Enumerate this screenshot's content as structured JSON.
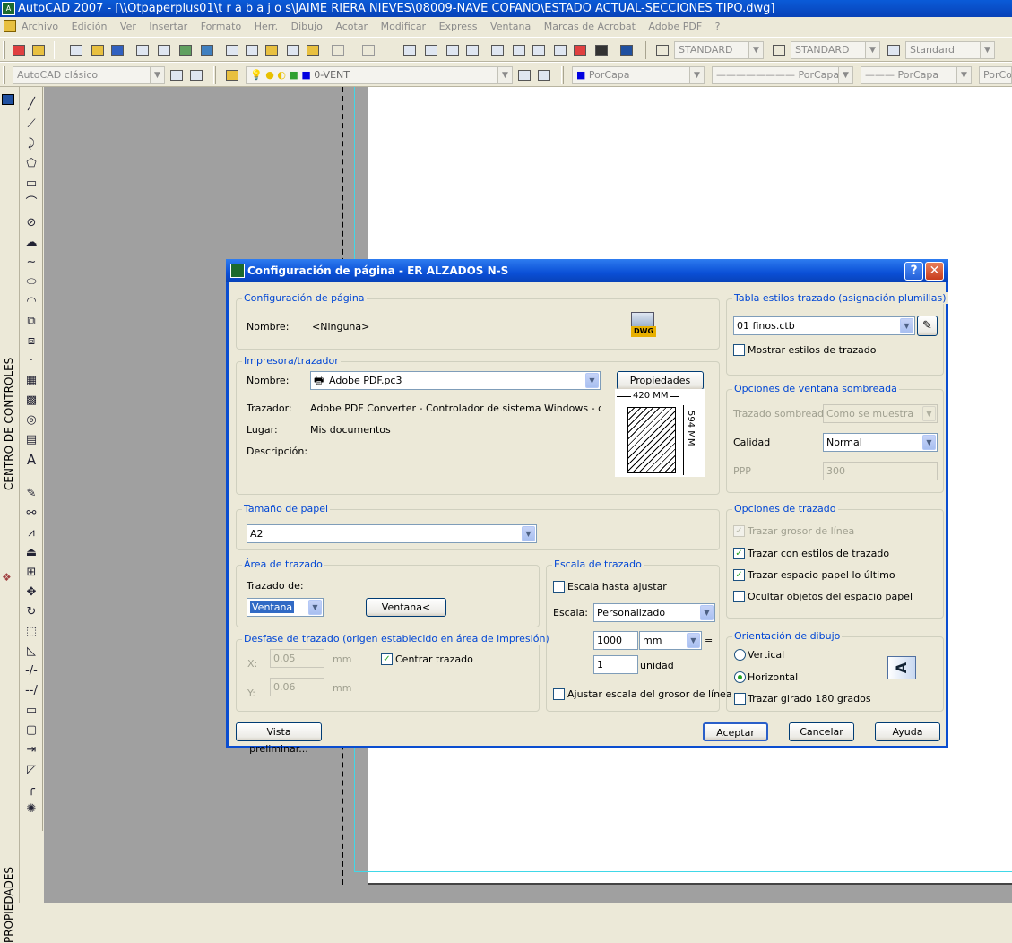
{
  "window": {
    "title": "AutoCAD 2007 - [\\\\Otpaperplus01\\t r a b a j o s\\JAIME RIERA NIEVES\\08009-NAVE COFANO\\ESTADO ACTUAL-SECCIONES TIPO.dwg]"
  },
  "menu": [
    "Archivo",
    "Edición",
    "Ver",
    "Insertar",
    "Formato",
    "Herr.",
    "Dibujo",
    "Acotar",
    "Modificar",
    "Express",
    "Ventana",
    "Marcas de Acrobat",
    "Adobe PDF",
    "?"
  ],
  "toolbar1": {
    "text_style": "STANDARD",
    "dim_style": "STANDARD",
    "table_style": "Standard"
  },
  "toolbar2": {
    "workspace": "AutoCAD clásico",
    "layer": "0-VENT",
    "color": "PorCapa",
    "linetype": "PorCapa",
    "lineweight": "PorCapa",
    "plotstyle": "PorCo"
  },
  "side_palettes": {
    "design_center": "CENTRO DE CONTROLES",
    "properties": "PROPIEDADES"
  },
  "dialog": {
    "title": "Configuración de página - ER  ALZADOS N-S",
    "help_glyph": "?",
    "close_glyph": "✕",
    "page_setup": {
      "legend": "Configuración de página",
      "name_label": "Nombre:",
      "name_value": "<Ninguna>",
      "dwg_badge": "DWG"
    },
    "printer": {
      "legend": "Impresora/trazador",
      "name_label": "Nombre:",
      "name_value": "Adobe PDF.pc3",
      "properties_button": "Propiedades",
      "plotter_label": "Trazador:",
      "plotter_value": "Adobe PDF Converter - Controlador de sistema Windows - de Au...",
      "where_label": "Lugar:",
      "where_value": "Mis documentos",
      "description_label": "Descripción:",
      "preview_width": "420  MM",
      "preview_height": "594  MM"
    },
    "paper_size": {
      "legend": "Tamaño de papel",
      "value": "A2"
    },
    "plot_area": {
      "legend": "Área de trazado",
      "what_label": "Trazado de:",
      "what_value": "Ventana",
      "window_button": "Ventana<"
    },
    "plot_offset": {
      "legend": "Desfase de trazado (origen establecido en área de impresión)",
      "x_label": "X:",
      "x_value": "0.05",
      "y_label": "Y:",
      "y_value": "0.06",
      "unit": "mm",
      "center_label": "Centrar trazado",
      "center_checked": true
    },
    "plot_scale": {
      "legend": "Escala de trazado",
      "fit_label": "Escala hasta ajustar",
      "scale_label": "Escala:",
      "scale_value": "Personalizado",
      "value1": "1000",
      "unit1": "mm",
      "equals": "=",
      "value2": "1",
      "unit2": "unidad",
      "lineweights_label": "Ajustar escala del grosor de línea"
    },
    "plot_style_table": {
      "legend": "Tabla estilos trazado (asignación plumillas)",
      "value": "01 finos.ctb",
      "display_label": "Mostrar estilos de trazado"
    },
    "shaded_viewport": {
      "legend": "Opciones de ventana sombreada",
      "shade_label": "Trazado sombreado",
      "shade_value": "Como se muestra",
      "quality_label": "Calidad",
      "quality_value": "Normal",
      "dpi_label": "PPP",
      "dpi_value": "300"
    },
    "plot_options": {
      "legend": "Opciones de trazado",
      "items": [
        {
          "label": "Trazar grosor de línea",
          "checked": true,
          "disabled": true
        },
        {
          "label": "Trazar con estilos de trazado",
          "checked": true,
          "disabled": false
        },
        {
          "label": "Trazar espacio papel lo último",
          "checked": true,
          "disabled": false
        },
        {
          "label": "Ocultar objetos del espacio papel",
          "checked": false,
          "disabled": false
        }
      ]
    },
    "orientation": {
      "legend": "Orientación de dibujo",
      "portrait": "Vertical",
      "landscape": "Horizontal",
      "upside_down": "Trazar girado 180 grados",
      "selected": "Horizontal",
      "icon_letter": "A"
    },
    "buttons": {
      "preview": "Vista preliminar...",
      "ok": "Aceptar",
      "cancel": "Cancelar",
      "help": "Ayuda"
    }
  }
}
